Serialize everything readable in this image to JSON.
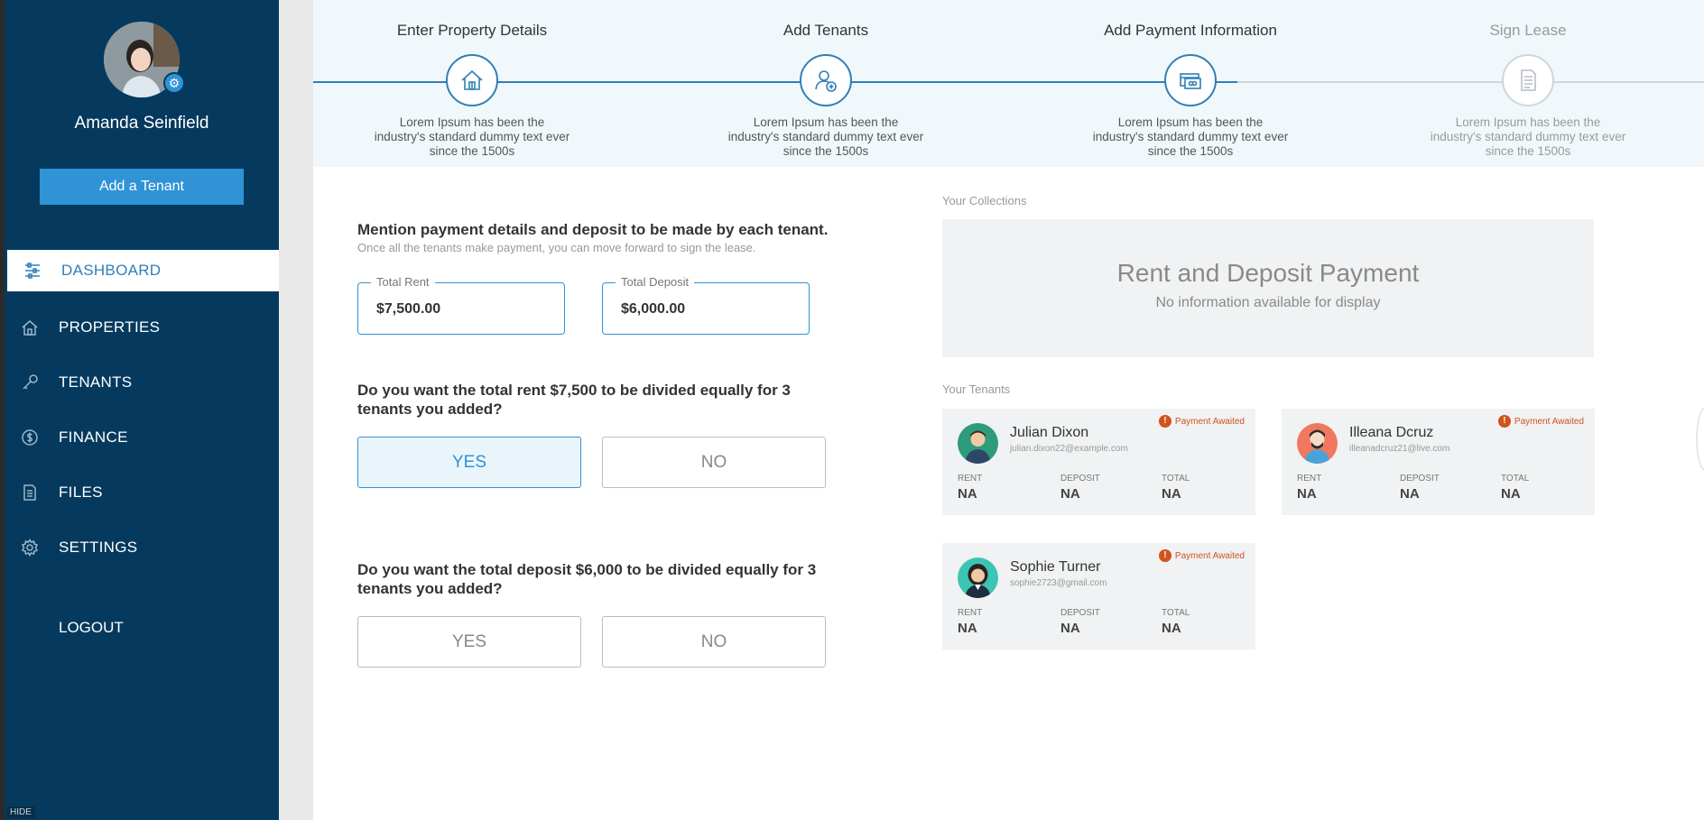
{
  "user": {
    "name": "Amanda Seinfield",
    "avatar_icon": "user-avatar-photo",
    "settings_icon": "gear-icon"
  },
  "sidebar": {
    "add_tenant_label": "Add a Tenant",
    "items": [
      {
        "label": "DASHBOARD",
        "icon": "dashboard-icon",
        "active": true
      },
      {
        "label": "PROPERTIES",
        "icon": "home-icon",
        "active": false
      },
      {
        "label": "TENANTS",
        "icon": "key-icon",
        "active": false
      },
      {
        "label": "FINANCE",
        "icon": "dollar-icon",
        "active": false
      },
      {
        "label": "FILES",
        "icon": "file-icon",
        "active": false
      },
      {
        "label": "SETTINGS",
        "icon": "gear-icon",
        "active": false
      }
    ],
    "logout_label": "LOGOUT",
    "hide_label": "HIDE"
  },
  "stepper": {
    "steps": [
      {
        "title": "Enter Property Details",
        "desc": "Lorem Ipsum has been the industry's standard dummy text ever since the 1500s",
        "icon": "house-icon",
        "completed": true
      },
      {
        "title": "Add Tenants",
        "desc": "Lorem Ipsum has been the industry's standard dummy text ever since the 1500s",
        "icon": "add-user-icon",
        "completed": true
      },
      {
        "title": "Add Payment Information",
        "desc": "Lorem Ipsum has been the industry's standard dummy text ever since the 1500s",
        "icon": "payment-card-icon",
        "completed": true
      },
      {
        "title": "Sign Lease",
        "desc": "Lorem Ipsum has been the industry's standard dummy text ever since the 1500s",
        "icon": "document-icon",
        "completed": false
      }
    ]
  },
  "form": {
    "title": "Mention payment details and deposit to be made by each tenant.",
    "subtitle": "Once all the tenants make payment, you can move forward to sign the lease.",
    "total_rent": {
      "label": "Total Rent",
      "value": "$7,500.00"
    },
    "total_deposit": {
      "label": "Total Deposit",
      "value": "$6,000.00"
    },
    "rent_question": "Do you want the total rent $7,500 to be divided equally for 3 tenants you added?",
    "deposit_question": "Do you want the total deposit $6,000 to be divided equally for 3 tenants you added?",
    "yes_label": "YES",
    "no_label": "NO",
    "rent_selected": "YES",
    "deposit_selected": ""
  },
  "collections": {
    "label": "Your Collections",
    "title": "Rent and Deposit Payment",
    "empty_text": "No information available for display"
  },
  "tenants": {
    "label": "Your Tenants",
    "rent_label": "RENT",
    "deposit_label": "DEPOSIT",
    "total_label": "TOTAL",
    "list": [
      {
        "name": "Julian Dixon",
        "email": "julian.dixon22@example.com",
        "status": "Payment Awaited",
        "rent": "NA",
        "deposit": "NA",
        "total": "NA",
        "avatar_color": "#2e9b7a"
      },
      {
        "name": "Illeana Dcruz",
        "email": "illeanadcruz21@live.com",
        "status": "Payment Awaited",
        "rent": "NA",
        "deposit": "NA",
        "total": "NA",
        "avatar_color": "#f0785e"
      },
      {
        "name": "Sophie Turner",
        "email": "sophie2723@gmail.com",
        "status": "Payment Awaited",
        "rent": "NA",
        "deposit": "NA",
        "total": "NA",
        "avatar_color": "#3cc4b4"
      }
    ]
  },
  "colors": {
    "sidebar_bg": "#053a5e",
    "accent": "#2f93d6",
    "warning": "#d0541a"
  }
}
